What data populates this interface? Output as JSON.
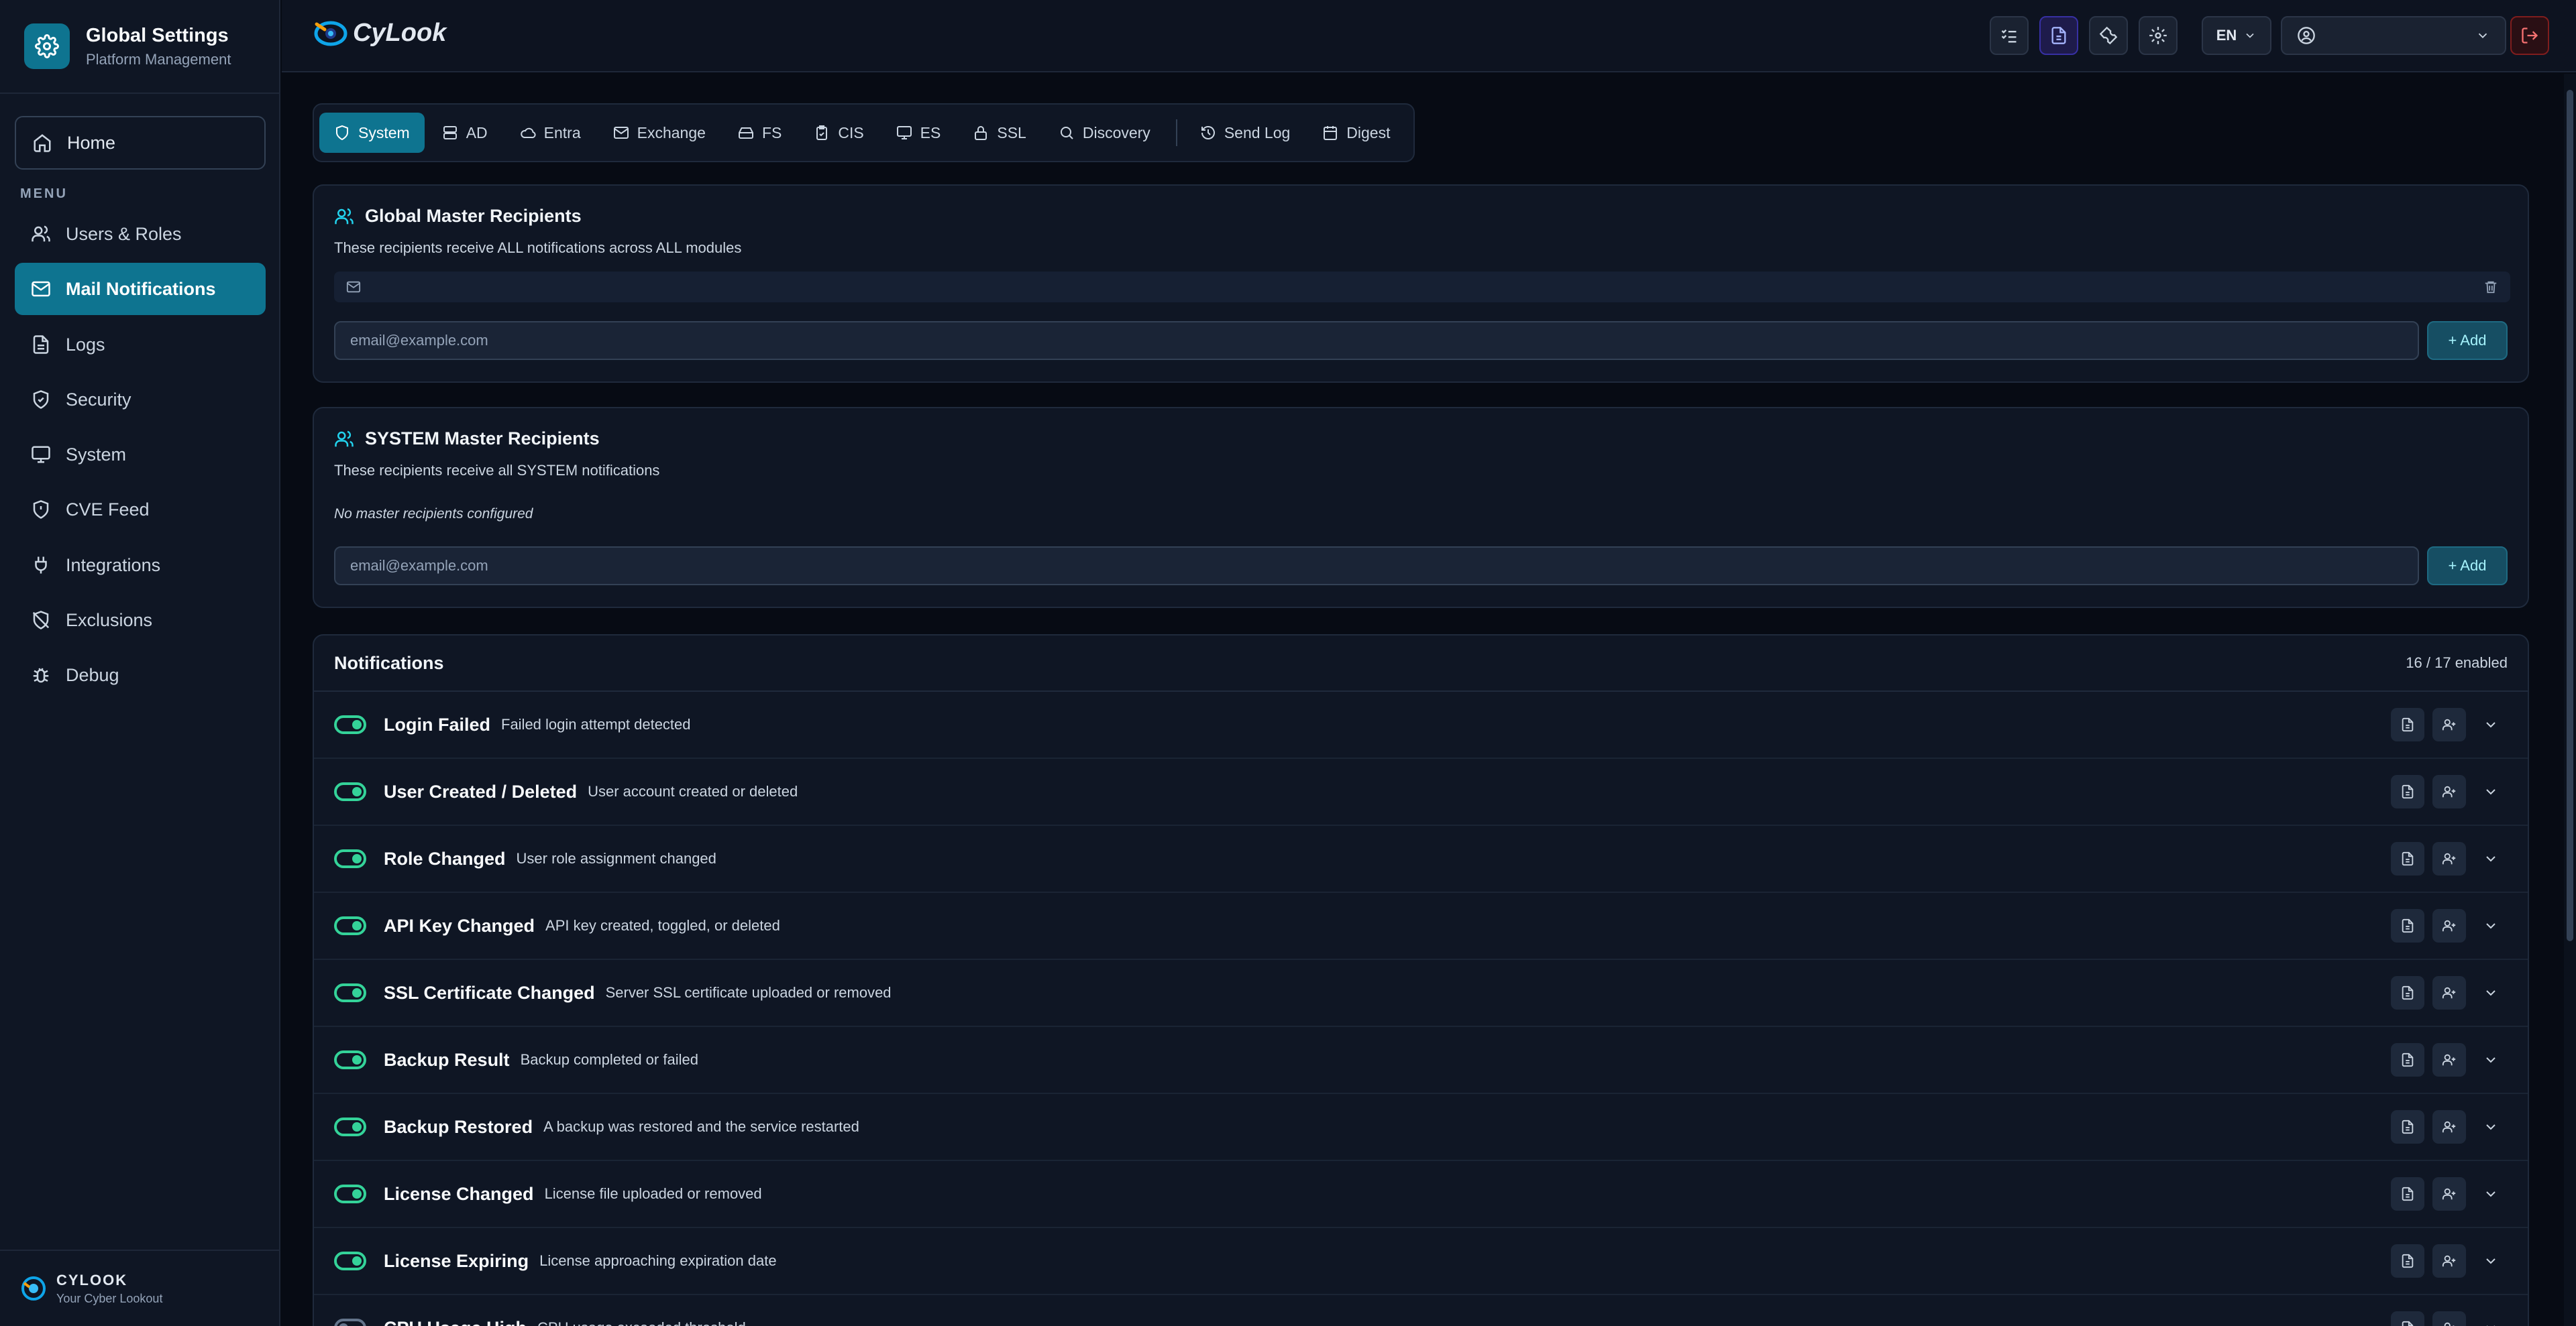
{
  "sidebar": {
    "title": "Global Settings",
    "subtitle": "Platform Management",
    "home": "Home",
    "menu_label": "MENU",
    "items": [
      {
        "label": "Users & Roles",
        "icon": "users-icon"
      },
      {
        "label": "Mail Notifications",
        "icon": "mail-icon",
        "active": true
      },
      {
        "label": "Logs",
        "icon": "logs-icon"
      },
      {
        "label": "Security",
        "icon": "shield-icon"
      },
      {
        "label": "System",
        "icon": "monitor-icon"
      },
      {
        "label": "CVE Feed",
        "icon": "shield-alert-icon"
      },
      {
        "label": "Integrations",
        "icon": "plug-icon"
      },
      {
        "label": "Exclusions",
        "icon": "shield-off-icon"
      },
      {
        "label": "Debug",
        "icon": "bug-icon"
      }
    ],
    "footer_title": "CYLOOK",
    "footer_sub": "Your Cyber Lookout"
  },
  "topbar": {
    "logo": "CyLook",
    "lang": "EN",
    "user": ""
  },
  "tabs": [
    {
      "label": "System",
      "active": true
    },
    {
      "label": "AD"
    },
    {
      "label": "Entra"
    },
    {
      "label": "Exchange"
    },
    {
      "label": "FS"
    },
    {
      "label": "CIS"
    },
    {
      "label": "ES"
    },
    {
      "label": "SSL"
    },
    {
      "label": "Discovery"
    },
    {
      "label": "Send Log"
    },
    {
      "label": "Digest"
    }
  ],
  "global_recipients": {
    "title": "Global Master Recipients",
    "description": "These recipients receive ALL notifications across ALL modules",
    "recipient": "",
    "placeholder": "email@example.com",
    "add_label": "+ Add"
  },
  "system_recipients": {
    "title": "SYSTEM Master Recipients",
    "description": "These recipients receive all SYSTEM notifications",
    "empty": "No master recipients configured",
    "placeholder": "email@example.com",
    "add_label": "+ Add"
  },
  "notifications": {
    "title": "Notifications",
    "count": "16 / 17 enabled",
    "items": [
      {
        "name": "Login Failed",
        "desc": "Failed login attempt detected",
        "enabled": true
      },
      {
        "name": "User Created / Deleted",
        "desc": "User account created or deleted",
        "enabled": true
      },
      {
        "name": "Role Changed",
        "desc": "User role assignment changed",
        "enabled": true
      },
      {
        "name": "API Key Changed",
        "desc": "API key created, toggled, or deleted",
        "enabled": true
      },
      {
        "name": "SSL Certificate Changed",
        "desc": "Server SSL certificate uploaded or removed",
        "enabled": true
      },
      {
        "name": "Backup Result",
        "desc": "Backup completed or failed",
        "enabled": true
      },
      {
        "name": "Backup Restored",
        "desc": "A backup was restored and the service restarted",
        "enabled": true
      },
      {
        "name": "License Changed",
        "desc": "License file uploaded or removed",
        "enabled": true
      },
      {
        "name": "License Expiring",
        "desc": "License approaching expiration date",
        "enabled": true
      },
      {
        "name": "CPU Usage High",
        "desc": "CPU usage exceeded threshold",
        "enabled": false
      }
    ]
  },
  "colors": {
    "accent": "#0e7490",
    "toggle_on": "#34d399",
    "background": "#070b14"
  }
}
